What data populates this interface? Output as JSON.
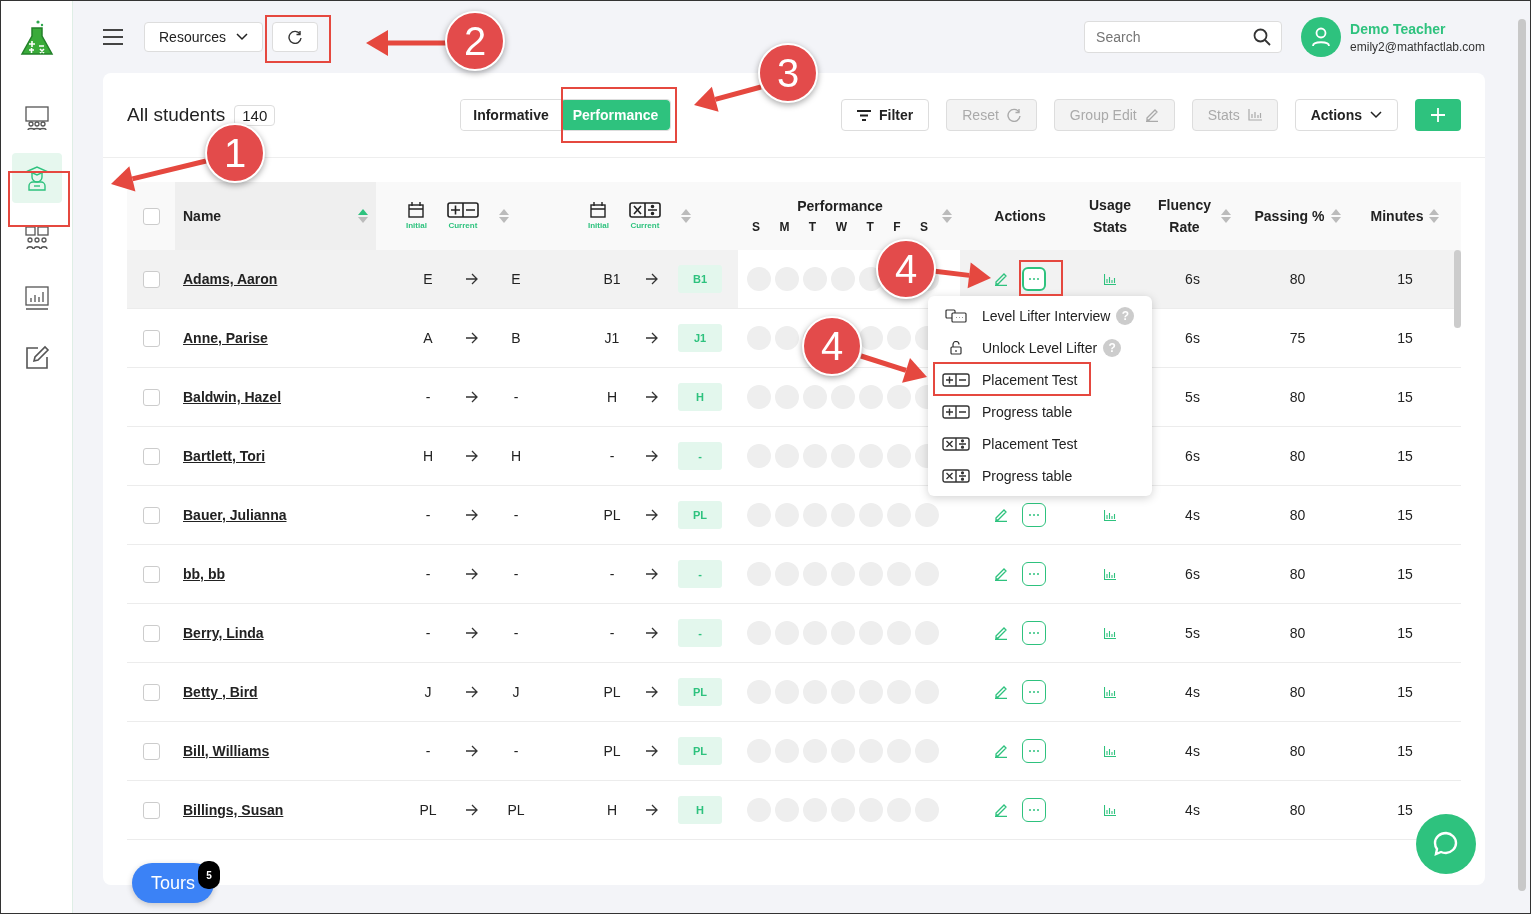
{
  "sidebar": {
    "items": [
      {
        "kind": "classroom",
        "selected": false
      },
      {
        "kind": "student",
        "selected": true
      },
      {
        "kind": "groups",
        "selected": false
      },
      {
        "kind": "reports",
        "selected": false
      },
      {
        "kind": "assign",
        "selected": false
      }
    ]
  },
  "topbar": {
    "resources": "Resources",
    "search": {
      "placeholder": "Search"
    },
    "user": {
      "name": "Demo Teacher",
      "email": "emily2@mathfactlab.com"
    }
  },
  "card": {
    "title": "All students",
    "count": "140",
    "views": [
      {
        "label": "Informative",
        "selected": false
      },
      {
        "label": "Performance",
        "selected": true
      }
    ],
    "buttons": [
      {
        "kind": "filter",
        "label": "Filter",
        "disabled": false
      },
      {
        "kind": "reset",
        "label": "Reset",
        "disabled": true
      },
      {
        "kind": "edit",
        "label": "Group Edit",
        "disabled": true
      },
      {
        "kind": "stats",
        "label": "Stats",
        "disabled": true
      },
      {
        "kind": "dropdown",
        "label": "Actions",
        "disabled": false
      }
    ]
  },
  "table": {
    "select_all": {
      "checked": false
    },
    "columns": {
      "name": {
        "label": "Name",
        "sort_active": true
      },
      "add_sub": {
        "initial": "Initial",
        "current": "Current",
        "sort_active": false
      },
      "mul_div": {
        "initial": "Initial",
        "current": "Current",
        "sort_active": false
      },
      "performance": {
        "label": "Performance",
        "days": [
          "S",
          "M",
          "T",
          "W",
          "T",
          "F",
          "S"
        ],
        "sort_active": false
      },
      "actions": {
        "label": "Actions"
      },
      "usage": {
        "label": "Usage Stats"
      },
      "fluency": {
        "label": "Fluency Rate",
        "sort_active": false
      },
      "passing": {
        "label": "Passing %",
        "sort_active": false
      },
      "minutes": {
        "label": "Minutes",
        "sort_active": false
      }
    },
    "rows": [
      {
        "name": "Adams, Aaron",
        "checked": false,
        "menu_open": true,
        "add_initial": "E",
        "add_current": "E",
        "mul_initial": "B1",
        "mul_current": "B1",
        "fluency": "6s",
        "passing": "80",
        "minutes": "15"
      },
      {
        "name": "Anne, Parise",
        "checked": false,
        "menu_open": false,
        "add_initial": "A",
        "add_current": "B",
        "mul_initial": "J1",
        "mul_current": "J1",
        "fluency": "6s",
        "passing": "75",
        "minutes": "15"
      },
      {
        "name": "Baldwin, Hazel",
        "checked": false,
        "menu_open": false,
        "add_initial": "-",
        "add_current": "-",
        "mul_initial": "H",
        "mul_current": "H",
        "fluency": "5s",
        "passing": "80",
        "minutes": "15"
      },
      {
        "name": "Bartlett, Tori",
        "checked": false,
        "menu_open": false,
        "add_initial": "H",
        "add_current": "H",
        "mul_initial": "-",
        "mul_current": "-",
        "fluency": "6s",
        "passing": "80",
        "minutes": "15"
      },
      {
        "name": "Bauer, Julianna",
        "checked": false,
        "menu_open": false,
        "add_initial": "-",
        "add_current": "-",
        "mul_initial": "PL",
        "mul_current": "PL",
        "fluency": "4s",
        "passing": "80",
        "minutes": "15"
      },
      {
        "name": "bb, bb",
        "checked": false,
        "menu_open": false,
        "add_initial": "-",
        "add_current": "-",
        "mul_initial": "-",
        "mul_current": "-",
        "fluency": "6s",
        "passing": "80",
        "minutes": "15"
      },
      {
        "name": "Berry, Linda",
        "checked": false,
        "menu_open": false,
        "add_initial": "-",
        "add_current": "-",
        "mul_initial": "-",
        "mul_current": "-",
        "fluency": "5s",
        "passing": "80",
        "minutes": "15"
      },
      {
        "name": "Betty , Bird",
        "checked": false,
        "menu_open": false,
        "add_initial": "J",
        "add_current": "J",
        "mul_initial": "PL",
        "mul_current": "PL",
        "fluency": "4s",
        "passing": "80",
        "minutes": "15"
      },
      {
        "name": "Bill, Williams",
        "checked": false,
        "menu_open": false,
        "add_initial": "-",
        "add_current": "-",
        "mul_initial": "PL",
        "mul_current": "PL",
        "fluency": "4s",
        "passing": "80",
        "minutes": "15"
      },
      {
        "name": "Billings, Susan",
        "checked": false,
        "menu_open": false,
        "add_initial": "PL",
        "add_current": "PL",
        "mul_initial": "H",
        "mul_current": "H",
        "fluency": "4s",
        "passing": "80",
        "minutes": "15"
      }
    ]
  },
  "row_menu": {
    "items": [
      {
        "kind": "interview",
        "label": "Level Lifter Interview",
        "help": "?"
      },
      {
        "kind": "unlock",
        "label": "Unlock Level Lifter",
        "help": "?"
      },
      {
        "kind": "add_sub",
        "label": "Placement Test"
      },
      {
        "kind": "add_sub",
        "label": "Progress table"
      },
      {
        "kind": "mul_div",
        "label": "Placement Test"
      },
      {
        "kind": "mul_div",
        "label": "Progress table"
      }
    ]
  },
  "tours": {
    "label": "Tours",
    "badge": "5"
  },
  "annotations": {
    "markers": [
      "1",
      "2",
      "3",
      "4",
      "4"
    ]
  }
}
